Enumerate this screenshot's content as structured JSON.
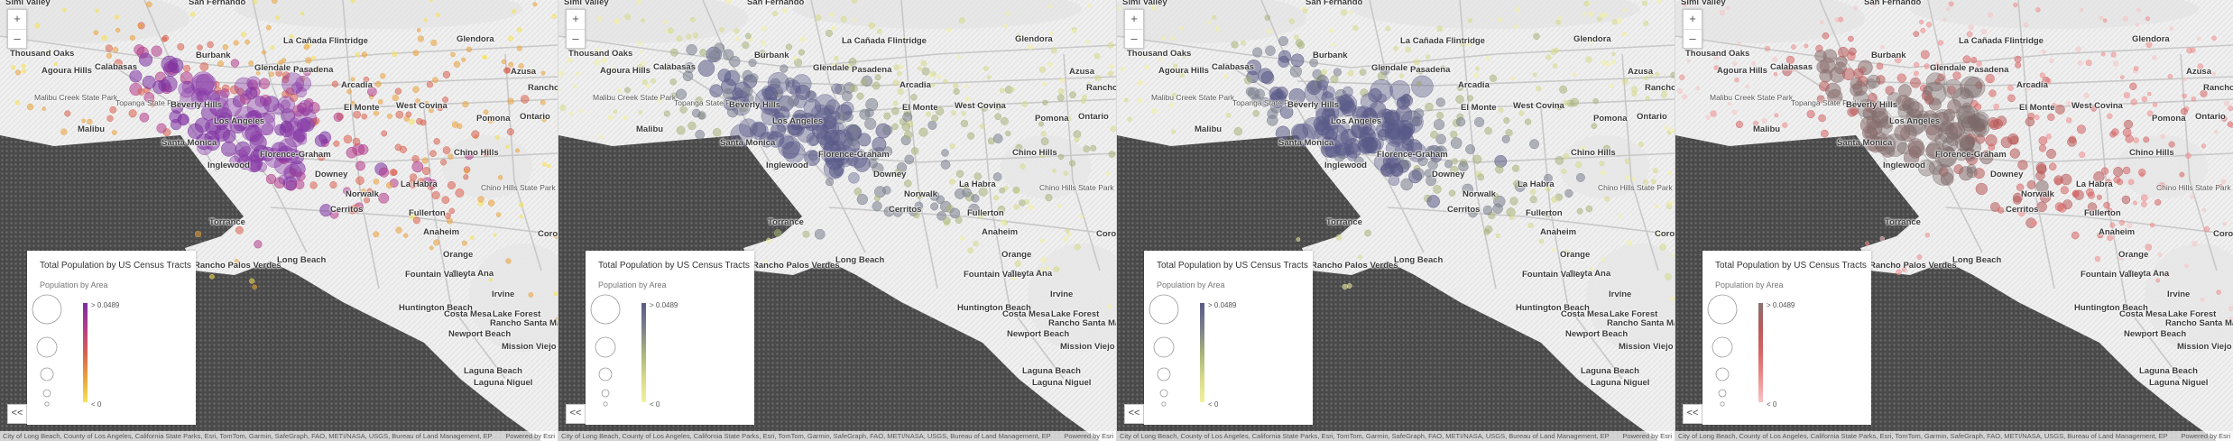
{
  "panels": [
    {
      "id": "purple",
      "ramp": [
        "#f6e254",
        "#e9a13a",
        "#d9604f",
        "#b23c8a",
        "#7b2fa0"
      ],
      "dense": "#8a3aa8"
    },
    {
      "id": "olive",
      "ramp": [
        "#f3f0a1",
        "#d6d98a",
        "#a7b27a",
        "#7a7f8e",
        "#5a5a86"
      ],
      "dense": "#5b5b8a"
    },
    {
      "id": "olive2",
      "ramp": [
        "#f3f0a1",
        "#d6d98a",
        "#a7b27a",
        "#7a7f8e",
        "#5a5a86"
      ],
      "dense": "#5b5b8a"
    },
    {
      "id": "red",
      "ramp": [
        "#f6c4c4",
        "#ee8d8d",
        "#d66565",
        "#b95a5a",
        "#8a7070"
      ],
      "dense": "#7a6a6a"
    }
  ],
  "legend": {
    "title": "Total Population by US Census Tracts",
    "subtitle": "Population by Area",
    "max_label": "> 0.0489",
    "min_label": "< 0"
  },
  "zoom": {
    "in_label": "+",
    "out_label": "–"
  },
  "expand_label": "<<",
  "attribution": {
    "text": "City of Long Beach, County of Los Angeles, California State Parks, Esri, TomTom, Garmin, SafeGraph, FAO, METI/NASA, USGS, Bureau of Land Management, EP",
    "powered": "Powered by Esri"
  },
  "cities": [
    {
      "name": "Simi Valley",
      "cls": ""
    },
    {
      "name": "San Fernando",
      "cls": ""
    },
    {
      "name": "Thousand Oaks",
      "cls": ""
    },
    {
      "name": "Agoura Hills",
      "cls": ""
    },
    {
      "name": "Calabasas",
      "cls": ""
    },
    {
      "name": "Burbank",
      "cls": ""
    },
    {
      "name": "La Cañada Flintridge",
      "cls": ""
    },
    {
      "name": "Glendale",
      "cls": ""
    },
    {
      "name": "Pasadena",
      "cls": ""
    },
    {
      "name": "Glendora",
      "cls": ""
    },
    {
      "name": "Arcadia",
      "cls": ""
    },
    {
      "name": "Azusa",
      "cls": ""
    },
    {
      "name": "Malibu Creek State Park",
      "cls": "small"
    },
    {
      "name": "Topanga State Park",
      "cls": "small"
    },
    {
      "name": "Beverly Hills",
      "cls": ""
    },
    {
      "name": "Los Angeles",
      "cls": ""
    },
    {
      "name": "El Monte",
      "cls": ""
    },
    {
      "name": "West Covina",
      "cls": ""
    },
    {
      "name": "Pomona",
      "cls": ""
    },
    {
      "name": "Rancho Cucamonga",
      "cls": ""
    },
    {
      "name": "Ontario",
      "cls": ""
    },
    {
      "name": "Malibu",
      "cls": ""
    },
    {
      "name": "Santa Monica",
      "cls": ""
    },
    {
      "name": "Florence-Graham",
      "cls": ""
    },
    {
      "name": "Inglewood",
      "cls": ""
    },
    {
      "name": "Downey",
      "cls": ""
    },
    {
      "name": "Chino Hills",
      "cls": ""
    },
    {
      "name": "La Habra",
      "cls": ""
    },
    {
      "name": "Norwalk",
      "cls": ""
    },
    {
      "name": "Chino Hills State Park",
      "cls": "small"
    },
    {
      "name": "Cerritos",
      "cls": ""
    },
    {
      "name": "Fullerton",
      "cls": ""
    },
    {
      "name": "Torrance",
      "cls": ""
    },
    {
      "name": "Anaheim",
      "cls": ""
    },
    {
      "name": "Corona",
      "cls": ""
    },
    {
      "name": "Rancho Palos Verdes",
      "cls": ""
    },
    {
      "name": "Long Beach",
      "cls": ""
    },
    {
      "name": "Orange",
      "cls": ""
    },
    {
      "name": "Santa Ana",
      "cls": ""
    },
    {
      "name": "Fountain Valley",
      "cls": ""
    },
    {
      "name": "Huntington Beach",
      "cls": ""
    },
    {
      "name": "Costa Mesa",
      "cls": ""
    },
    {
      "name": "Irvine",
      "cls": ""
    },
    {
      "name": "Lake Forest",
      "cls": ""
    },
    {
      "name": "Rancho Santa Margarita",
      "cls": ""
    },
    {
      "name": "Newport Beach",
      "cls": ""
    },
    {
      "name": "Mission Viejo",
      "cls": ""
    },
    {
      "name": "Laguna Beach",
      "cls": ""
    },
    {
      "name": "Laguna Niguel",
      "cls": ""
    }
  ]
}
